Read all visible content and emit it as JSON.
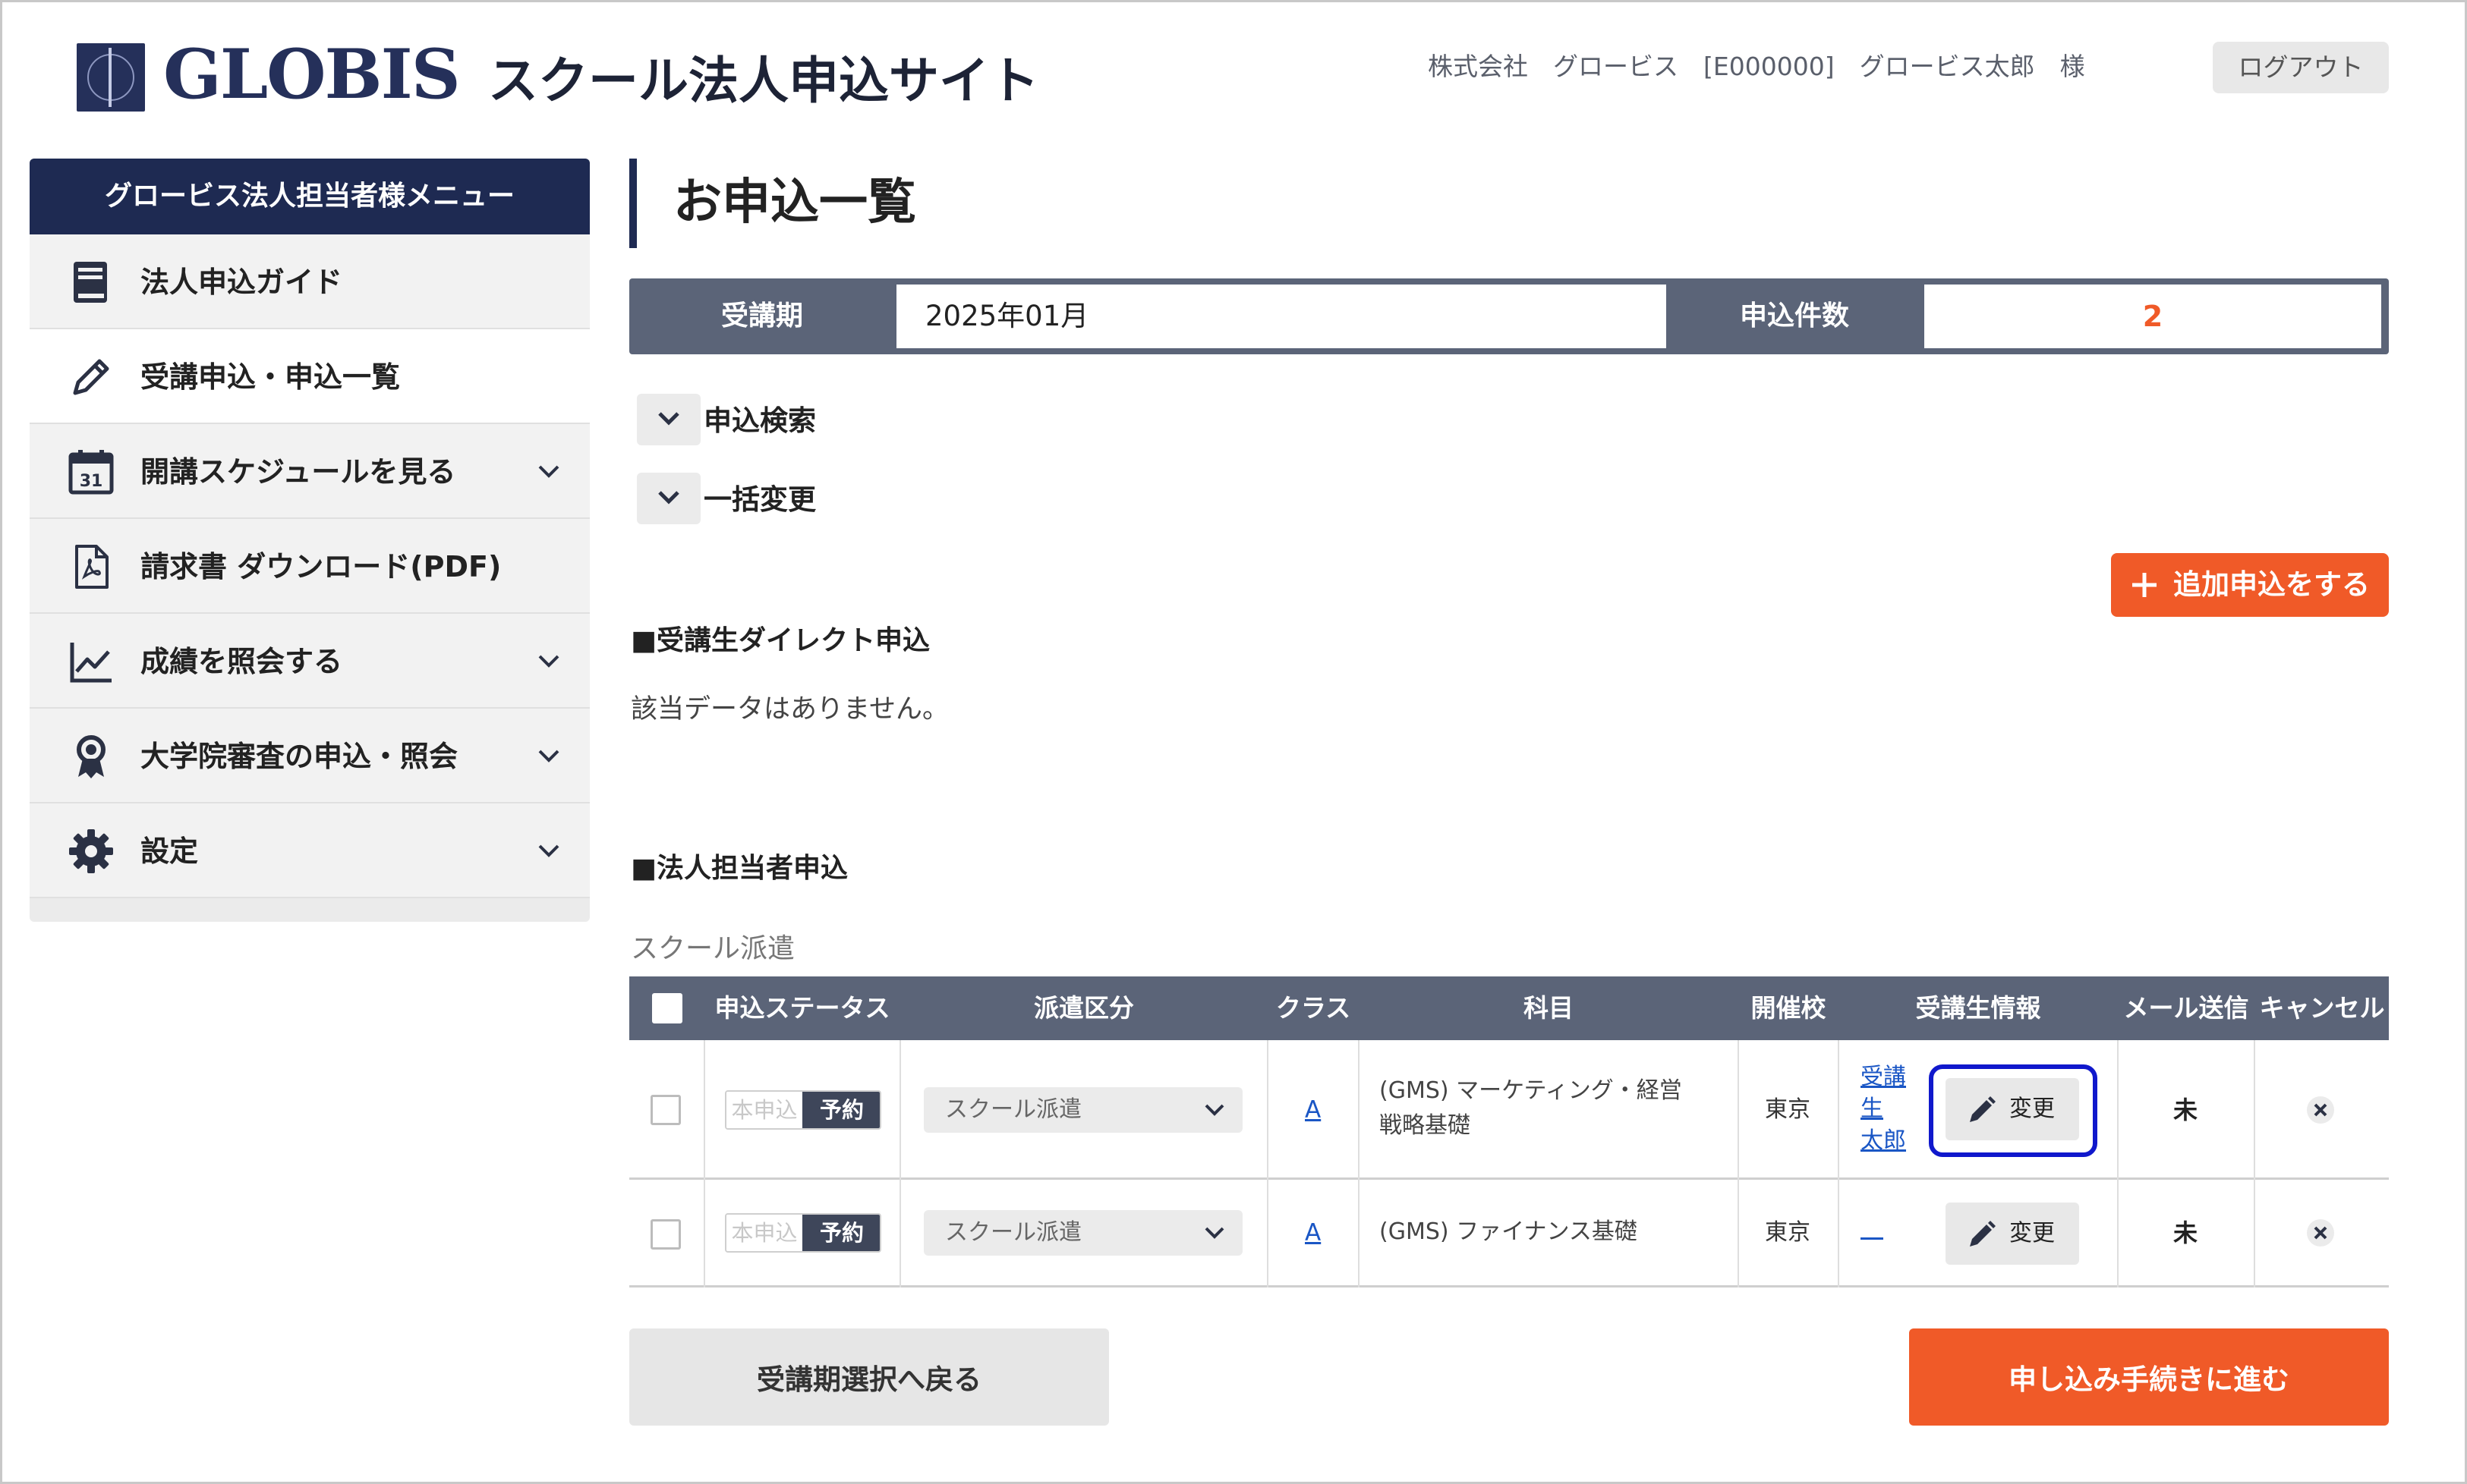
{
  "header": {
    "logo_text": "GLOBIS",
    "site_title": "スクール法人申込サイト",
    "user_info": "株式会社　グロービス　[E000000]　グロービス太郎　様",
    "logout_label": "ログアウト"
  },
  "sidebar": {
    "heading": "グロービス法人担当者様メニュー",
    "items": [
      {
        "label": "法人申込ガイド",
        "icon": "book-icon",
        "active": false,
        "expandable": false
      },
      {
        "label": "受講申込・申込一覧",
        "icon": "pencil-icon",
        "active": true,
        "expandable": false
      },
      {
        "label": "開講スケジュールを見る",
        "icon": "calendar-icon",
        "calendar_day": "31",
        "active": false,
        "expandable": true
      },
      {
        "label": "請求書 ダウンロード(PDF)",
        "icon": "pdf-icon",
        "active": false,
        "expandable": false
      },
      {
        "label": "成績を照会する",
        "icon": "line-chart-icon",
        "active": false,
        "expandable": true
      },
      {
        "label": "大学院審査の申込・照会",
        "icon": "award-icon",
        "active": false,
        "expandable": true
      },
      {
        "label": "設定",
        "icon": "gear-icon",
        "active": false,
        "expandable": true
      }
    ]
  },
  "main": {
    "page_title": "お申込一覧",
    "summary": {
      "term_label": "受講期",
      "term_value": "2025年01月",
      "count_label": "申込件数",
      "count_value": "2"
    },
    "toggles": {
      "search_label": "申込検索",
      "bulk_label": "一括変更"
    },
    "add_button_label": "追加申込をする",
    "direct_section": {
      "heading": "■受講生ダイレクト申込",
      "empty_message": "該当データはありません。"
    },
    "corporate_section": {
      "heading": "■法人担当者申込",
      "subheading": "スクール派遣"
    },
    "table": {
      "columns": [
        "申込ステータス",
        "派遣区分",
        "クラス",
        "科目",
        "開催校",
        "受講生情報",
        "メール送信",
        "キャンセル"
      ],
      "rows": [
        {
          "status_off": "本申込",
          "status_on": "予約",
          "dispatch": "スクール派遣",
          "class": "A",
          "subject_line1": "(GMS) マーケティング・経営",
          "subject_line2": "戦略基礎",
          "venue": "東京",
          "student_line1": "受講",
          "student_line2": "生",
          "student_line3": "太郎",
          "edit_label": "変更",
          "mail": "未",
          "highlighted": true
        },
        {
          "status_off": "本申込",
          "status_on": "予約",
          "dispatch": "スクール派遣",
          "class": "A",
          "subject_line1": "(GMS) ファイナンス基礎",
          "subject_line2": "",
          "venue": "東京",
          "student_line1": "＿",
          "edit_label": "変更",
          "mail": "未",
          "highlighted": false
        }
      ]
    },
    "back_button_label": "受講期選択へ戻る",
    "proceed_button_label": "申し込み手続きに進む"
  },
  "colors": {
    "navy": "#1e2a52",
    "slate": "#5b6478",
    "orange": "#f05a28",
    "link_blue": "#1a56c5",
    "highlight_blue": "#1018cc"
  }
}
